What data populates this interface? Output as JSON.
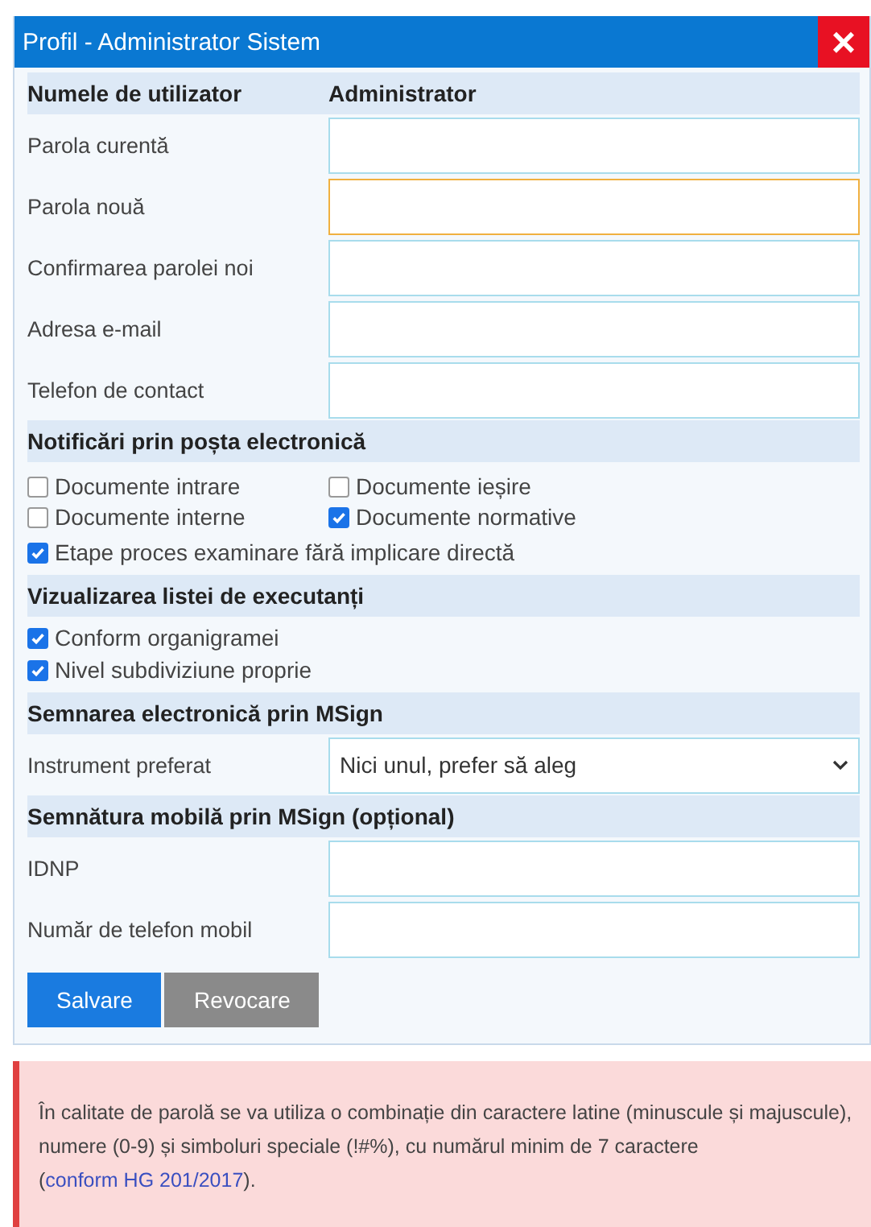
{
  "window": {
    "title": "Profil - Administrator Sistem",
    "close": "×"
  },
  "username": {
    "label": "Numele de utilizator",
    "value": "Administrator"
  },
  "fields": [
    {
      "label": "Parola curentă",
      "focused": false
    },
    {
      "label": "Parola nouă",
      "focused": true
    },
    {
      "label": "Confirmarea parolei noi",
      "focused": false
    },
    {
      "label": "Adresa e-mail",
      "focused": false
    },
    {
      "label": "Telefon de contact",
      "focused": false
    }
  ],
  "notifications": {
    "title": "Notificări prin poșta electronică",
    "grid": [
      {
        "label": "Documente intrare",
        "checked": false
      },
      {
        "label": "Documente ieșire",
        "checked": false
      },
      {
        "label": "Documente interne",
        "checked": false
      },
      {
        "label": "Documente normative",
        "checked": true
      }
    ],
    "extra": {
      "label": "Etape proces examinare fără implicare directă",
      "checked": true
    }
  },
  "executants": {
    "title": "Vizualizarea listei de executanți",
    "options": [
      {
        "label": "Conform organigramei",
        "checked": true
      },
      {
        "label": "Nivel subdiviziune proprie",
        "checked": true
      }
    ]
  },
  "msign": {
    "title": "Semnarea electronică prin MSign",
    "label": "Instrument preferat",
    "value": "Nici unul, prefer să aleg"
  },
  "mobile": {
    "title": "Semnătura mobilă prin MSign (opțional)",
    "fields": [
      {
        "label": "IDNP",
        "focused": false
      },
      {
        "label": "Număr de telefon mobil",
        "focused": false
      }
    ]
  },
  "buttons": [
    {
      "label": "Salvare",
      "kind": "primary"
    },
    {
      "label": "Revocare",
      "kind": "secondary"
    }
  ],
  "notice": {
    "text": "În calitate de parolă se va utiliza o combinație din caractere latine (minuscule și majuscule), numere (0-9) și simboluri speciale (!#%), cu numărul minim de 7 caractere (",
    "link": "conform HG 201/2017",
    "tail": ")."
  }
}
